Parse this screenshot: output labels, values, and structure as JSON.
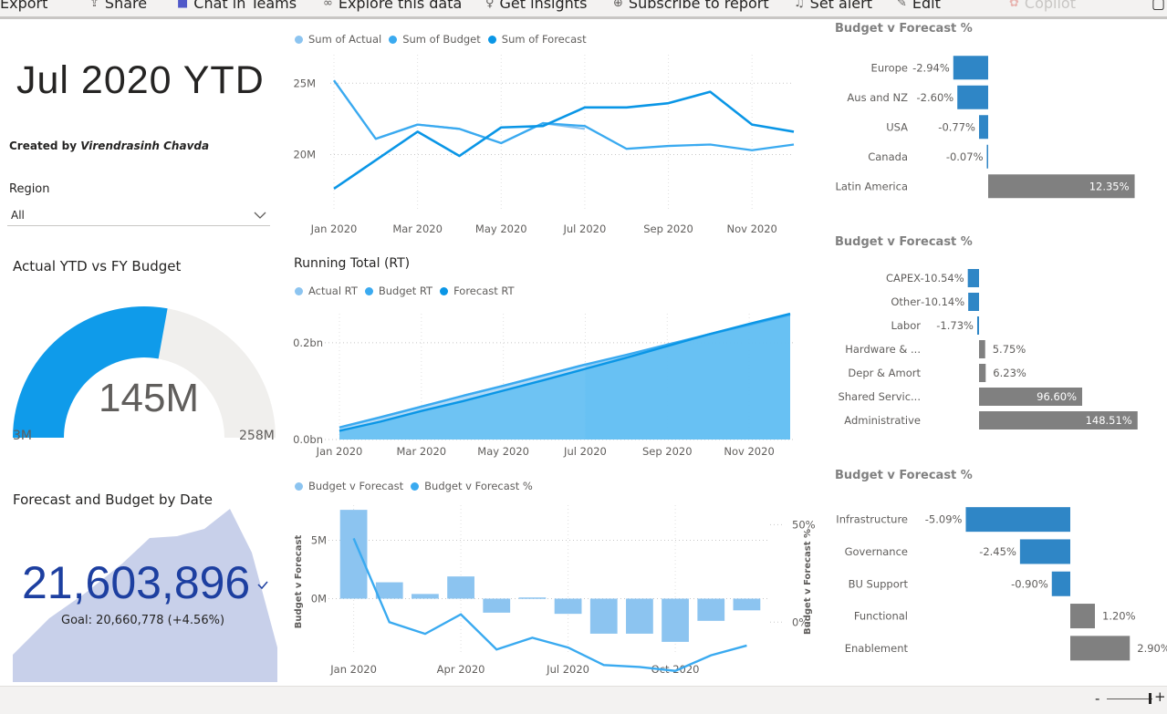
{
  "toolbar": {
    "items": [
      {
        "label": "Export",
        "icon": "export-icon"
      },
      {
        "label": "Share",
        "icon": "share-icon"
      },
      {
        "label": "Chat in Teams",
        "icon": "teams-icon"
      },
      {
        "label": "Explore this data",
        "icon": "explore-icon"
      },
      {
        "label": "Get insights",
        "icon": "lightbulb-icon"
      },
      {
        "label": "Subscribe to report",
        "icon": "subscribe-icon"
      },
      {
        "label": "Set alert",
        "icon": "bell-icon"
      },
      {
        "label": "Edit",
        "icon": "pencil-icon"
      },
      {
        "label": "Copilot",
        "icon": "copilot-icon"
      }
    ]
  },
  "page": {
    "title": "Jul 2020 YTD",
    "created_prefix": "Created by ",
    "created_author": "Virendrasinh Chavda",
    "region_label": "Region",
    "region_value": "All"
  },
  "gauge": {
    "title": "Actual YTD vs FY Budget",
    "value_label": "145M",
    "min_label": "3M",
    "max_label": "258M",
    "min": 3,
    "max": 258,
    "value": 145,
    "fill_color": "#0f9bea",
    "track_color": "#f0efed"
  },
  "kpi": {
    "title": "Forecast and Budget by Date",
    "value": "21,603,896",
    "goal": "Goal: 20,660,778 (+4.56%)",
    "value_color": "#1d3fa0",
    "area_color": "#c8d0ea"
  },
  "chart_data": [
    {
      "id": "monthly",
      "type": "line",
      "legend": [
        "Sum of Actual",
        "Sum of Budget",
        "Sum of Forecast"
      ],
      "colors": [
        "#8cc4f0",
        "#3aaaf0",
        "#0a96e6"
      ],
      "x": [
        "Jan 2020",
        "Feb 2020",
        "Mar 2020",
        "Apr 2020",
        "May 2020",
        "Jun 2020",
        "Jul 2020",
        "Aug 2020",
        "Sep 2020",
        "Oct 2020",
        "Nov 2020",
        "Dec 2020"
      ],
      "x_ticks": [
        "Jan 2020",
        "Mar 2020",
        "May 2020",
        "Jul 2020",
        "Sep 2020",
        "Nov 2020"
      ],
      "y_ticks": [
        "25M",
        "20M"
      ],
      "y_tick_values": [
        25,
        20
      ],
      "ylim": [
        16,
        27
      ],
      "series": [
        {
          "name": "Sum of Actual",
          "values": [
            25.2,
            21.1,
            22.1,
            21.8,
            20.8,
            22.2,
            21.8,
            null,
            null,
            null,
            null,
            null
          ]
        },
        {
          "name": "Sum of Budget",
          "values": [
            25.2,
            21.1,
            22.1,
            21.8,
            20.8,
            22.2,
            22.0,
            20.4,
            20.6,
            20.7,
            20.3,
            20.7
          ]
        },
        {
          "name": "Sum of Forecast",
          "values": [
            17.6,
            19.6,
            21.6,
            19.9,
            21.9,
            22.0,
            23.3,
            23.3,
            23.6,
            24.4,
            22.1,
            21.6
          ]
        }
      ]
    },
    {
      "id": "running",
      "type": "area",
      "title": "Running Total (RT)",
      "legend": [
        "Actual RT",
        "Budget RT",
        "Forecast RT"
      ],
      "colors": [
        "#8cc4f0",
        "#3aaaf0",
        "#0a96e6"
      ],
      "x": [
        "Jan 2020",
        "Feb 2020",
        "Mar 2020",
        "Apr 2020",
        "May 2020",
        "Jun 2020",
        "Jul 2020",
        "Aug 2020",
        "Sep 2020",
        "Oct 2020",
        "Nov 2020",
        "Dec 2020"
      ],
      "x_ticks": [
        "Jan 2020",
        "Mar 2020",
        "May 2020",
        "Jul 2020",
        "Sep 2020",
        "Nov 2020"
      ],
      "y_ticks": [
        "0.2bn",
        "0.0bn"
      ],
      "y_tick_values": [
        0.2,
        0.0
      ],
      "ylim": [
        0,
        0.26
      ],
      "series": [
        {
          "name": "Actual RT",
          "values": [
            0.025,
            0.046,
            0.068,
            0.09,
            0.111,
            0.133,
            0.155,
            null,
            null,
            null,
            null,
            null
          ]
        },
        {
          "name": "Budget RT",
          "values": [
            0.025,
            0.046,
            0.068,
            0.09,
            0.111,
            0.133,
            0.155,
            0.175,
            0.196,
            0.217,
            0.237,
            0.258
          ]
        },
        {
          "name": "Forecast RT",
          "values": [
            0.018,
            0.037,
            0.059,
            0.079,
            0.101,
            0.123,
            0.146,
            0.169,
            0.193,
            0.217,
            0.239,
            0.26
          ]
        }
      ]
    },
    {
      "id": "variance",
      "type": "bar",
      "legend": [
        "Budget v Forecast",
        "Budget v Forecast %"
      ],
      "colors": [
        "#8cc4f0",
        "#3aaaf0"
      ],
      "ylabel": "Budget v Forecast",
      "y2label": "Budget v Forecast %",
      "categories": [
        "Jan 2020",
        "Feb 2020",
        "Mar 2020",
        "Apr 2020",
        "May 2020",
        "Jun 2020",
        "Jul 2020",
        "Aug 2020",
        "Sep 2020",
        "Oct 2020",
        "Nov 2020",
        "Dec 2020"
      ],
      "x_ticks": [
        "Jan 2020",
        "Apr 2020",
        "Jul 2020",
        "Oct 2020"
      ],
      "y_ticks": [
        "5M",
        "0M"
      ],
      "y_tick_values": [
        5,
        0
      ],
      "y2_ticks": [
        "50%",
        "0%"
      ],
      "y2_tick_values": [
        50,
        0
      ],
      "ylim": [
        -4.8,
        8
      ],
      "y2lim": [
        -16.7,
        60
      ],
      "bar_values": [
        7.6,
        1.4,
        0.4,
        1.9,
        -1.2,
        0.1,
        -1.3,
        -3.0,
        -3.0,
        -3.7,
        -1.9,
        -1.0
      ],
      "line_values": [
        43,
        0,
        -6,
        4,
        -14,
        -8,
        -13,
        -22,
        -23,
        -25,
        -17,
        -12
      ]
    }
  ],
  "bars_region": {
    "title": "Budget v Forecast %",
    "rows": [
      {
        "label": "Europe",
        "value": -2.94,
        "text": "-2.94%"
      },
      {
        "label": "Aus and NZ",
        "value": -2.6,
        "text": "-2.60%"
      },
      {
        "label": "USA",
        "value": -0.77,
        "text": "-0.77%"
      },
      {
        "label": "Canada",
        "value": -0.07,
        "text": "-0.07%"
      },
      {
        "label": "Latin America",
        "value": 12.35,
        "text": "12.35%"
      }
    ]
  },
  "bars_category": {
    "title": "Budget v Forecast %",
    "rows": [
      {
        "label": "CAPEX",
        "value": -10.54,
        "text": "-10.54%"
      },
      {
        "label": "Other",
        "value": -10.14,
        "text": "-10.14%"
      },
      {
        "label": "Labor",
        "value": -1.73,
        "text": "-1.73%"
      },
      {
        "label": "Hardware & ...",
        "value": 5.75,
        "text": "5.75%"
      },
      {
        "label": "Depr & Amort",
        "value": 6.23,
        "text": "6.23%"
      },
      {
        "label": "Shared Servic...",
        "value": 96.6,
        "text": "96.60%"
      },
      {
        "label": "Administrative",
        "value": 148.51,
        "text": "148.51%"
      }
    ]
  },
  "bars_function": {
    "title": "Budget v Forecast %",
    "rows": [
      {
        "label": "Infrastructure",
        "value": -5.09,
        "text": "-5.09%"
      },
      {
        "label": "Governance",
        "value": -2.45,
        "text": "-2.45%"
      },
      {
        "label": "BU Support",
        "value": -0.9,
        "text": "-0.90%"
      },
      {
        "label": "Functional",
        "value": 1.2,
        "text": "1.20%"
      },
      {
        "label": "Enablement",
        "value": 2.9,
        "text": "2.90%"
      }
    ]
  },
  "colors": {
    "negative_bar": "#2f86c6",
    "positive_bar": "#808080"
  },
  "zoom": {
    "minus": "-",
    "plus": "+"
  }
}
